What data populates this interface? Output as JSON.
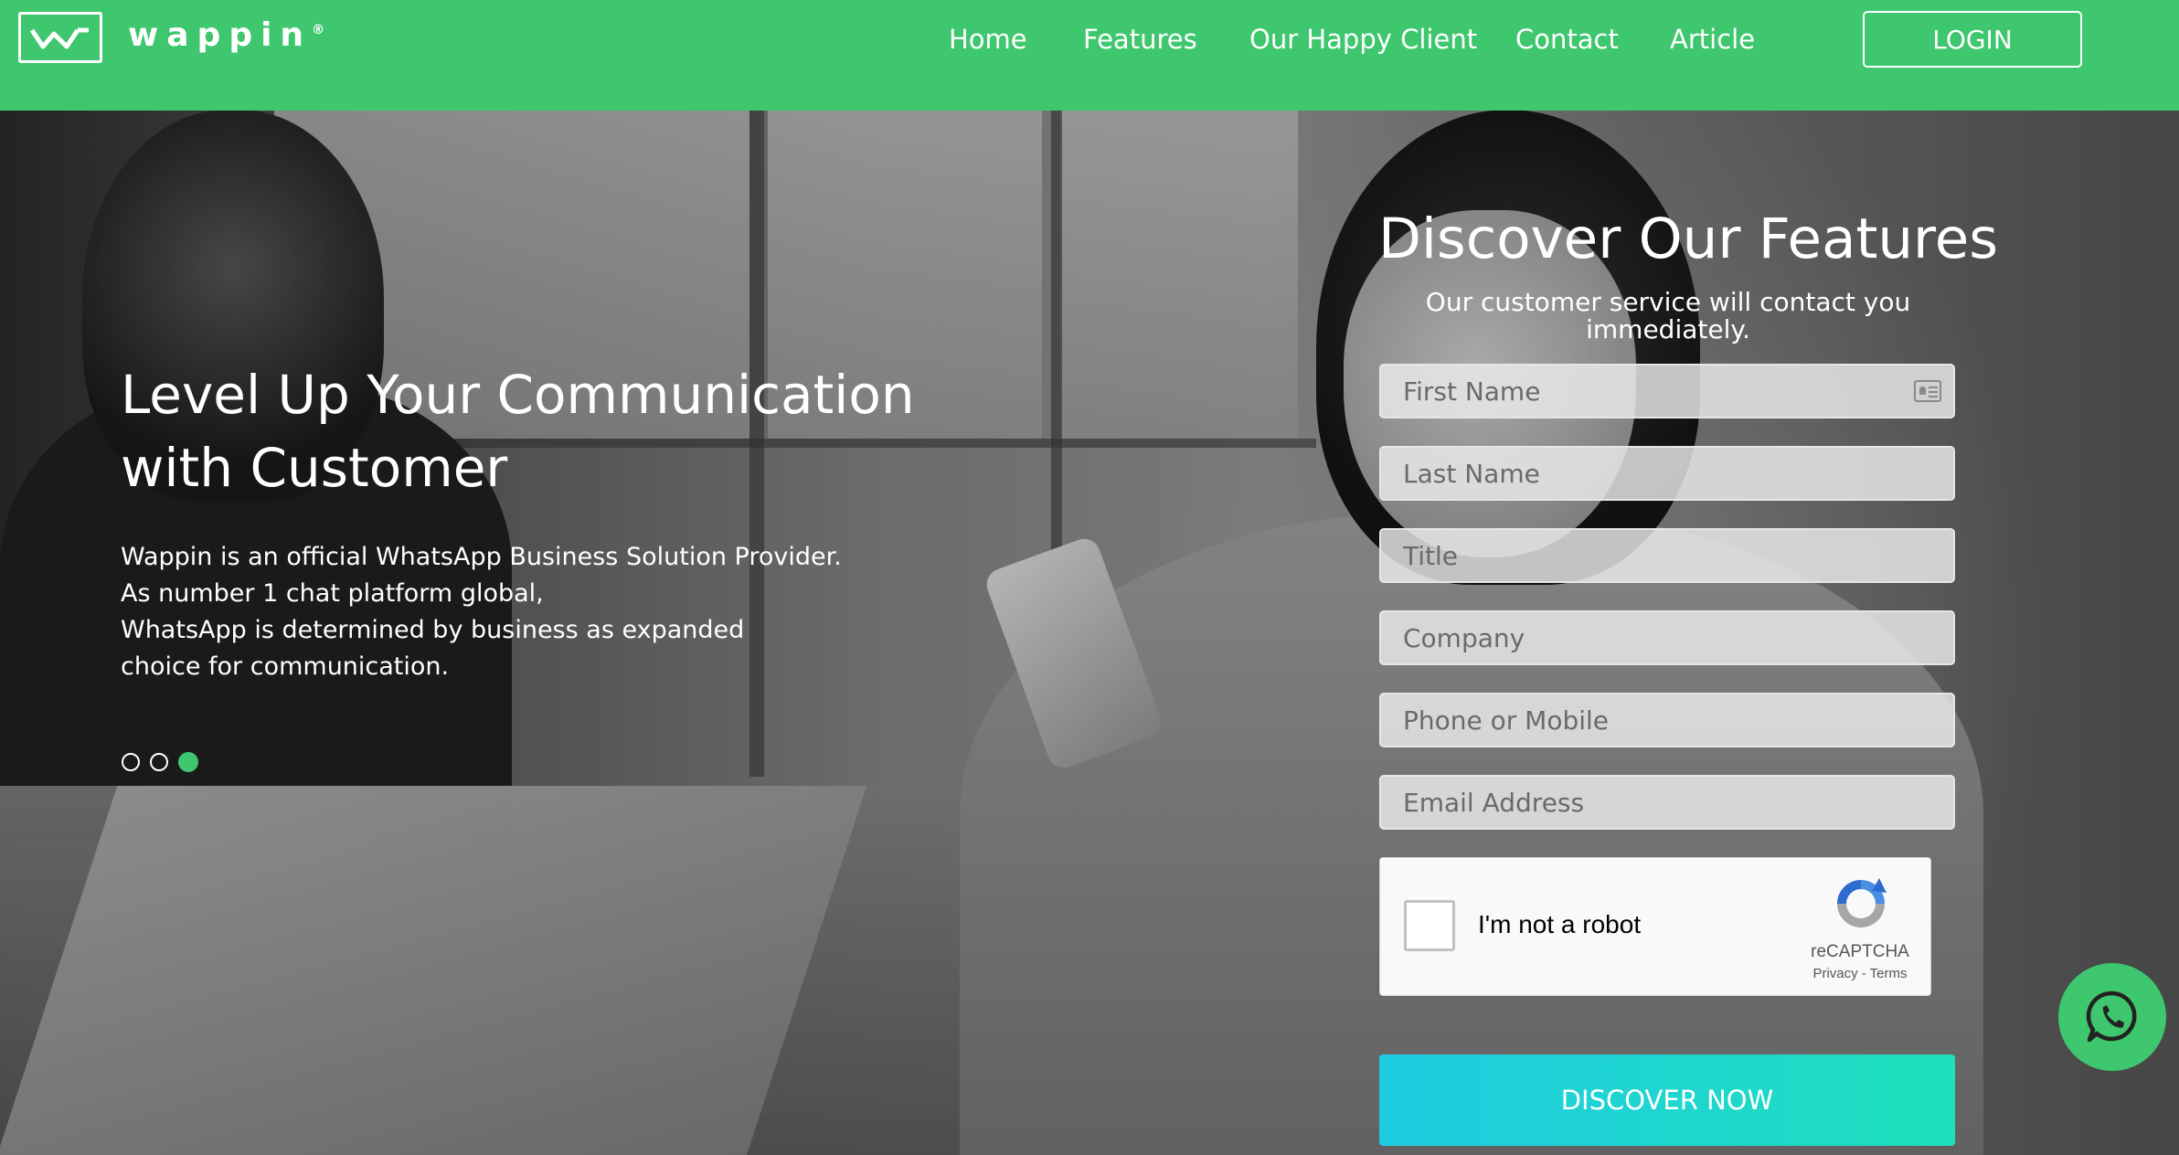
{
  "brand": {
    "name": "wappin",
    "mark": "®"
  },
  "nav": {
    "items": [
      "Home",
      "Features",
      "Our Happy Client",
      "Contact",
      "Article"
    ],
    "login_label": "LOGIN"
  },
  "hero": {
    "title": "Level Up Your Communication with Customer",
    "description_lines": [
      "Wappin is an official WhatsApp Business Solution Provider.",
      "As number 1 chat platform global,",
      "WhatsApp is determined by business as expanded",
      "choice for communication."
    ],
    "slides": {
      "count": 3,
      "active_index": 2
    }
  },
  "form": {
    "title": "Discover Our Features",
    "subtitle": "Our customer service will contact you immediately.",
    "placeholders": {
      "first_name": "First Name",
      "last_name": "Last Name",
      "title": "Title",
      "company": "Company",
      "phone": "Phone or Mobile",
      "email": "Email Address"
    },
    "captcha": {
      "label": "I'm not a robot",
      "brand": "reCAPTCHA",
      "links": "Privacy - Terms"
    },
    "submit_label": "DISCOVER NOW"
  },
  "icons": {
    "contact_card": "contact-card-icon",
    "whatsapp": "whatsapp-icon",
    "recaptcha": "recaptcha-logo-icon"
  },
  "colors": {
    "brand_green": "#3ec76e",
    "button_gradient_start": "#1fcbe2",
    "button_gradient_end": "#1ee0bc"
  }
}
